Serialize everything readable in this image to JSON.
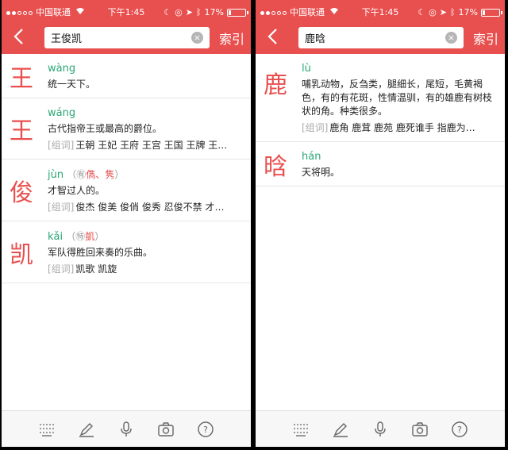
{
  "status_bar": {
    "carrier": "中国联通",
    "time": "下午1:45",
    "battery": "17%",
    "battery_level": 0.17
  },
  "left": {
    "search": {
      "value": "王俊凯",
      "index_label": "索引"
    },
    "entries": [
      {
        "char": "王",
        "pinyin": "wàng",
        "meaning": "统一天下。"
      },
      {
        "char": "王",
        "pinyin": "wáng",
        "meaning": "古代指帝王或最高的爵位。",
        "words_tag": "[组词]",
        "words": "王朝 王妃 王府 王宫 王国 王牌 王…"
      },
      {
        "char": "俊",
        "pinyin": "jùn",
        "variant_prefix": "（㊒",
        "variant_alt": "儁、隽",
        "variant_suffix": "）",
        "meaning": "才智过人的。",
        "words_tag": "[组词]",
        "words": "俊杰 俊美 俊俏 俊秀 忍俊不禁 才…"
      },
      {
        "char": "凯",
        "pinyin": "kǎi",
        "variant_prefix": "（㊕",
        "variant_alt": "凱",
        "variant_suffix": "）",
        "meaning": "军队得胜回来奏的乐曲。",
        "words_tag": "[组词]",
        "words": "凯歌 凯旋"
      }
    ]
  },
  "right": {
    "search": {
      "value": "鹿晗",
      "index_label": "索引"
    },
    "entries": [
      {
        "char": "鹿",
        "pinyin": "lù",
        "meaning": "哺乳动物，反刍类，腿细长，尾短，毛黄褐色，有的有花斑，性情温驯，有的雄鹿有树枝状的角。种类很多。",
        "words_tag": "[组词]",
        "words": "鹿角 鹿茸 鹿苑 鹿死谁手 指鹿为…"
      },
      {
        "char": "晗",
        "pinyin": "hán",
        "meaning": "天将明。"
      }
    ]
  },
  "toolbar_icons": [
    "keyboard-icon",
    "pencil-icon",
    "microphone-icon",
    "camera-icon",
    "help-icon"
  ],
  "colors": {
    "accent": "#e8504f",
    "pinyin": "#2aa773"
  }
}
